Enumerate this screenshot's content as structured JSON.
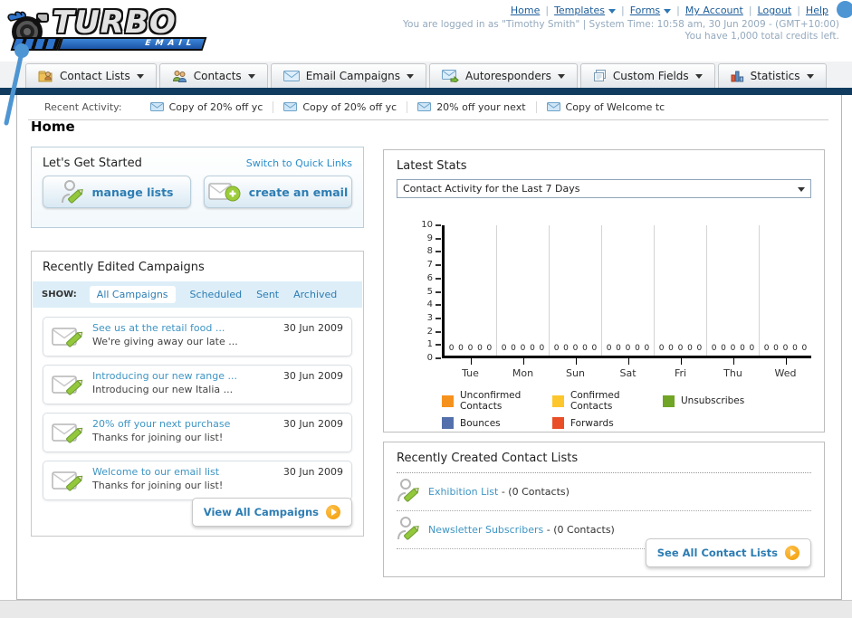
{
  "header": {
    "logo_title": "TURBO",
    "logo_subtitle": "EMAIL",
    "nav_links": [
      {
        "label": "Home"
      },
      {
        "label": "Templates",
        "dropdown": true
      },
      {
        "label": "Forms",
        "dropdown": true
      },
      {
        "label": "My Account"
      },
      {
        "label": "Logout"
      },
      {
        "label": "Help"
      }
    ],
    "login_line": "You are logged in as \"Timothy Smith\" | System Time: 10:58 am, 30 Jun 2009 - (GMT+10:00)",
    "credits_line": "You have 1,000 total credits left."
  },
  "nav_tabs": [
    {
      "label": "Contact Lists",
      "icon": "contact-lists-folder-icon"
    },
    {
      "label": "Contacts",
      "icon": "contacts-people-icon"
    },
    {
      "label": "Email Campaigns",
      "icon": "email-campaigns-envelope-icon"
    },
    {
      "label": "Autoresponders",
      "icon": "autoresponders-envelope-arrow-icon"
    },
    {
      "label": "Custom Fields",
      "icon": "custom-fields-pages-icon"
    },
    {
      "label": "Statistics",
      "icon": "statistics-chart-icon"
    }
  ],
  "recent_activity": {
    "label": "Recent Activity:",
    "items": [
      "Copy of 20% off yc",
      "Copy of 20% off yc",
      "20% off your next",
      "Copy of Welcome tc"
    ]
  },
  "page_title": "Home",
  "get_started": {
    "title": "Let's Get Started",
    "switch_link": "Switch to Quick Links",
    "buttons": [
      {
        "label": "manage lists",
        "icon": "person-pencil-icon"
      },
      {
        "label": "create an email",
        "icon": "envelope-plus-icon"
      }
    ]
  },
  "campaigns": {
    "title": "Recently Edited Campaigns",
    "show_label": "SHOW:",
    "filters": [
      "All Campaigns",
      "Scheduled",
      "Sent",
      "Archived"
    ],
    "active_filter": "All Campaigns",
    "items": [
      {
        "title": "See us at the retail food ...",
        "subtitle": "We're giving away our late ...",
        "date": "30 Jun 2009"
      },
      {
        "title": "Introducing our new range ...",
        "subtitle": "Introducing our new Italia ...",
        "date": "30 Jun 2009"
      },
      {
        "title": "20% off your next purchase",
        "subtitle": "Thanks for joining our list!",
        "date": "30 Jun 2009"
      },
      {
        "title": "Welcome to our email list",
        "subtitle": "Thanks for joining our list!",
        "date": "30 Jun 2009"
      }
    ],
    "view_all_label": "View All Campaigns"
  },
  "stats": {
    "title": "Latest Stats",
    "dropdown_value": "Contact Activity for the Last 7 Days"
  },
  "chart_data": {
    "type": "bar",
    "title": "Contact Activity for the Last 7 Days",
    "categories": [
      "Tue",
      "Mon",
      "Sun",
      "Sat",
      "Fri",
      "Thu",
      "Wed"
    ],
    "series": [
      {
        "name": "Unconfirmed Contacts",
        "color": "#f5921e",
        "values": [
          0,
          0,
          0,
          0,
          0,
          0,
          0
        ]
      },
      {
        "name": "Confirmed Contacts",
        "color": "#fdc62c",
        "values": [
          0,
          0,
          0,
          0,
          0,
          0,
          0
        ]
      },
      {
        "name": "Unsubscribes",
        "color": "#70a525",
        "values": [
          0,
          0,
          0,
          0,
          0,
          0,
          0
        ]
      },
      {
        "name": "Bounces",
        "color": "#5470ac",
        "values": [
          0,
          0,
          0,
          0,
          0,
          0,
          0
        ]
      },
      {
        "name": "Forwards",
        "color": "#e94e26",
        "values": [
          0,
          0,
          0,
          0,
          0,
          0,
          0
        ]
      }
    ],
    "ylim": [
      0,
      10
    ],
    "yticks": [
      0,
      1,
      2,
      3,
      4,
      5,
      6,
      7,
      8,
      9,
      10
    ],
    "grid": "vertical",
    "legend_position": "bottom"
  },
  "contact_lists": {
    "title": "Recently Created Contact Lists",
    "items": [
      {
        "name": "Exhibition List",
        "detail": "- (0 Contacts)"
      },
      {
        "name": "Newsletter Subscribers",
        "detail": "- (0 Contacts)"
      }
    ],
    "see_all_label": "See All Contact Lists"
  }
}
